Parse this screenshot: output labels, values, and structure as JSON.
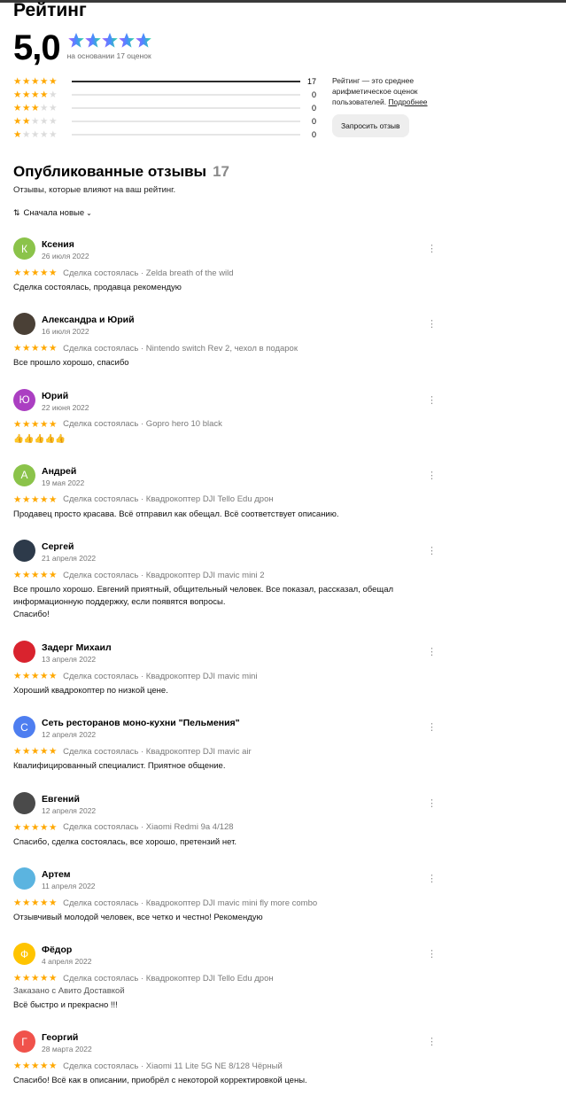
{
  "page": {
    "title": "Рейтинг"
  },
  "summary": {
    "score": "5,0",
    "count_text": "на основании 17 оценок",
    "histogram": [
      {
        "stars": 5,
        "count": "17",
        "fraction": 1.0
      },
      {
        "stars": 4,
        "count": "0",
        "fraction": 0
      },
      {
        "stars": 3,
        "count": "0",
        "fraction": 0
      },
      {
        "stars": 2,
        "count": "0",
        "fraction": 0
      },
      {
        "stars": 1,
        "count": "0",
        "fraction": 0
      }
    ],
    "info_text": "Рейтинг — это среднее арифметическое оценок пользователей.",
    "info_link": "Подробнее",
    "request_button": "Запросить отзыв"
  },
  "published": {
    "title": "Опубликованные отзывы",
    "count": "17",
    "subtitle": "Отзывы, которые влияют на ваш рейтинг.",
    "sort_label": "Сначала новые"
  },
  "colors": {
    "star": "#ffa800",
    "star_off": "#dcdcdc"
  },
  "reviews": [
    {
      "name": "Ксения",
      "date": "26 июля 2022",
      "deal": "Сделка состоялась · Zelda breath of the wild",
      "text": "Сделка состоялась, продавца рекомендую",
      "avatar_letter": "К",
      "avatar_color": "#8bc34a"
    },
    {
      "name": "Александра и Юрий",
      "date": "16 июля 2022",
      "deal": "Сделка состоялась · Nintendo switch Rev 2, чехол в подарок",
      "text": "Все прошло хорошо, спасибо",
      "avatar_letter": "",
      "avatar_color": "#4a4036"
    },
    {
      "name": "Юрий",
      "date": "22 июня 2022",
      "deal": "Сделка состоялась · Gopro hero 10 black",
      "text": "👍👍👍👍👍",
      "avatar_letter": "Ю",
      "avatar_color": "#ab3fc2"
    },
    {
      "name": "Андрей",
      "date": "19 мая 2022",
      "deal": "Сделка состоялась · Квадрокоптер DJI Tello Edu дрон",
      "text": "Продавец просто красава. Всё отправил как обещал. Всё соответствует описанию.",
      "avatar_letter": "А",
      "avatar_color": "#8bc34a"
    },
    {
      "name": "Сергей",
      "date": "21 апреля 2022",
      "deal": "Сделка состоялась · Квадрокоптер DJI mavic mini 2",
      "text_lines": [
        "Все прошло хорошо. Евгений приятный, общительный человек. Все показал, рассказал, обещал",
        "информационную поддержку, если появятся вопросы.",
        "Спасибо!"
      ],
      "avatar_letter": "",
      "avatar_color": "#2d3a4a"
    },
    {
      "name": "Задерг Михаил",
      "date": "13 апреля 2022",
      "deal": "Сделка состоялась · Квадрокоптер DJI mavic mini",
      "text": "Хороший квадрокоптер по низкой цене.",
      "avatar_letter": "",
      "avatar_color": "#d9232e"
    },
    {
      "name": "Сеть ресторанов моно-кухни \"Пельмения\"",
      "date": "12 апреля 2022",
      "deal": "Сделка состоялась · Квадрокоптер DJI mavic air",
      "text": "Квалифицированный специалист. Приятное общение.",
      "avatar_letter": "С",
      "avatar_color": "#4e7ef0"
    },
    {
      "name": "Евгений",
      "date": "12 апреля 2022",
      "deal": "Сделка состоялась · Xiaomi Redmi 9a 4/128",
      "text": "Спасибо, сделка состоялась, все хорошо, претензий нет.",
      "avatar_letter": "",
      "avatar_color": "#4a4a4a"
    },
    {
      "name": "Артем",
      "date": "11 апреля 2022",
      "deal": "Сделка состоялась · Квадрокоптер DJI mavic mini fly more combo",
      "text": "Отзывчивый молодой человек, все четко и честно! Рекомендую",
      "avatar_letter": "",
      "avatar_color": "#5bb4e0"
    },
    {
      "name": "Фёдор",
      "date": "4 апреля 2022",
      "deal": "Сделка состоялась · Квадрокоптер DJI Tello Edu дрон",
      "delivery": "Заказано с Авито Доставкой",
      "text": "Всё быстро и прекрасно !!!",
      "avatar_letter": "Ф",
      "avatar_color": "#ffc400"
    },
    {
      "name": "Георгий",
      "date": "28 марта 2022",
      "deal": "Сделка состоялась · Xiaomi 11 Lite 5G NE 8/128 Чёрный",
      "text": "Спасибо! Всё как в описании, приобрёл с некоторой корректировкой цены.",
      "avatar_letter": "Г",
      "avatar_color": "#f0524b"
    }
  ]
}
